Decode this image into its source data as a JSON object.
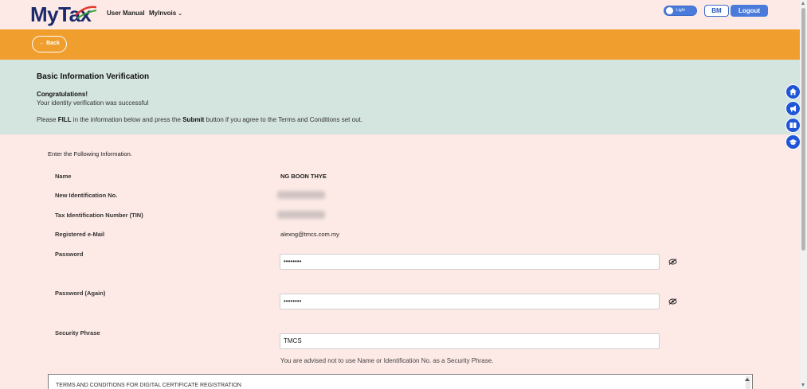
{
  "header": {
    "logo_my": "My",
    "logo_tax": "Tax",
    "nav": [
      {
        "label": "User Manual"
      },
      {
        "label": "MyInvois",
        "has_dropdown": true
      }
    ],
    "theme_toggle_label": "Light",
    "language_button": "BM",
    "logout_button": "Logout"
  },
  "backbar": {
    "back_label": "← Back"
  },
  "verification": {
    "title": "Basic Information Verification",
    "congrats": "Congratulations!",
    "success": "Your identity verification was successful",
    "instruct_1": "Please ",
    "instruct_fill": "FILL",
    "instruct_2": " in the information below and press the ",
    "instruct_submit": "Submit",
    "instruct_3": " button if you agree to the Terms and Conditions set out."
  },
  "form": {
    "intro": "Enter the Following Information.",
    "name_label": "Name",
    "name_value": "NG BOON THYE",
    "new_id_label": "New Identification No.",
    "tin_label": "Tax Identification Number (TIN)",
    "email_label": "Registered e-Mail",
    "email_value": "alexng@tmcs.com.my",
    "password_label": "Password",
    "password_value": "••••••••",
    "password_again_label": "Password (Again)",
    "password_again_value": "••••••••",
    "security_label": "Security Phrase",
    "security_value": "TMCS",
    "security_advice": "You are advised not to use Name or Identification No. as a Security Phrase."
  },
  "terms": {
    "heading": "TERMS AND CONDITIONS FOR DIGITAL CERTIFICATE REGISTRATION"
  },
  "side_icons": [
    "home-icon",
    "announcement-icon",
    "book-icon",
    "graduation-cap-icon"
  ],
  "colors": {
    "page_bg": "#fdeae6",
    "back_bar": "#f09e2e",
    "verify_panel": "#d4e4df",
    "accent_blue": "#4a7bdb",
    "side_icon_blue": "#1f55d6"
  }
}
